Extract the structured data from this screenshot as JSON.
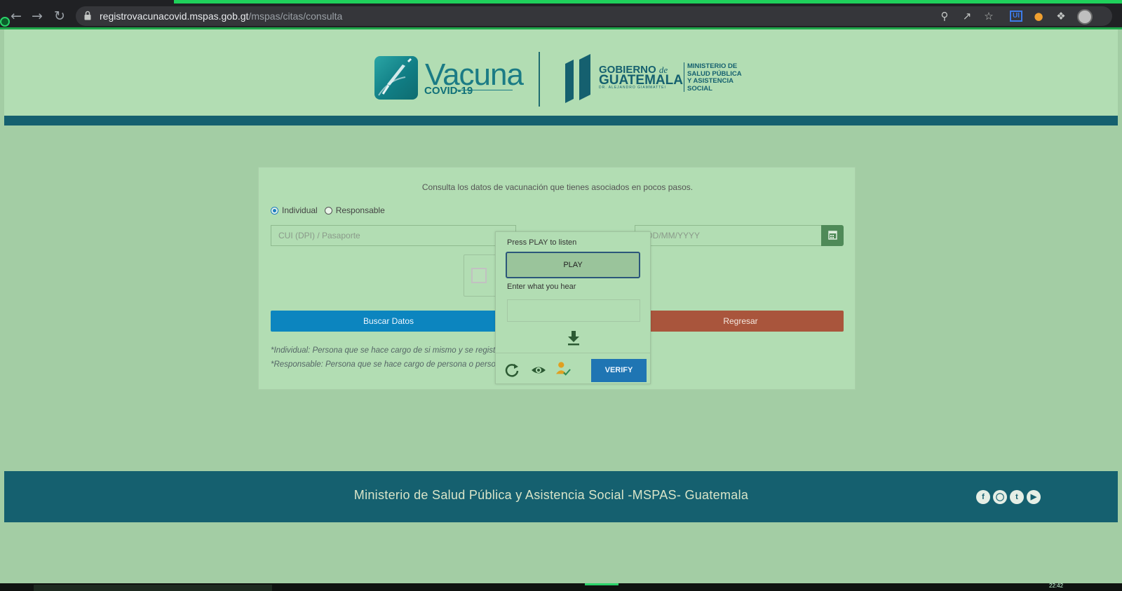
{
  "browser": {
    "url_domain": "registrovacunacovid.mspas.gob.gt",
    "url_path": "/mspas/citas/consulta",
    "extension_label": "UI"
  },
  "header": {
    "logo_vacuna": "Vacuna",
    "logo_covid": "COVID-19",
    "gob_line1": "GOBIERNO",
    "gob_de": "de",
    "gob_line2": "GUATEMALA",
    "gob_sub": "DR. ALEJANDRO GIAMMATTEI",
    "ministerio_lines": [
      "MINISTERIO DE",
      "SALUD PÚBLICA",
      "Y ASISTENCIA",
      "SOCIAL"
    ]
  },
  "form": {
    "intro": "Consulta los datos de vacunación que tienes asociados en pocos pasos.",
    "radio_individual": "Individual",
    "radio_responsable": "Responsable",
    "selected": "Individual",
    "cui_placeholder": "CUI (DPI) / Pasaporte",
    "date_placeholder": "DD/MM/YYYY",
    "buscar_label": "Buscar Datos",
    "regresar_label": "Regresar",
    "note_individual": "*Individual: Persona que se hace cargo de si mismo y se registró con CUI (DPI).",
    "note_responsable": "*Responsable: Persona que se hace cargo de persona o personas sin código único de identificación"
  },
  "captcha": {
    "press_play": "Press PLAY to listen",
    "play_label": "PLAY",
    "enter_label": "Enter what you hear",
    "verify_label": "VERIFY"
  },
  "footer": {
    "text": "Ministerio de Salud Pública y Asistencia Social -MSPAS- Guatemala",
    "social": [
      "facebook",
      "instagram",
      "twitter",
      "youtube"
    ]
  },
  "taskbar": {
    "time": "22:42"
  },
  "colors": {
    "page_bg": "#a3cda4",
    "brand_teal": "#15606f",
    "buscar_blue": "#0c85bf",
    "regresar_red": "#a9553c",
    "verify_blue": "#1f75b3"
  }
}
